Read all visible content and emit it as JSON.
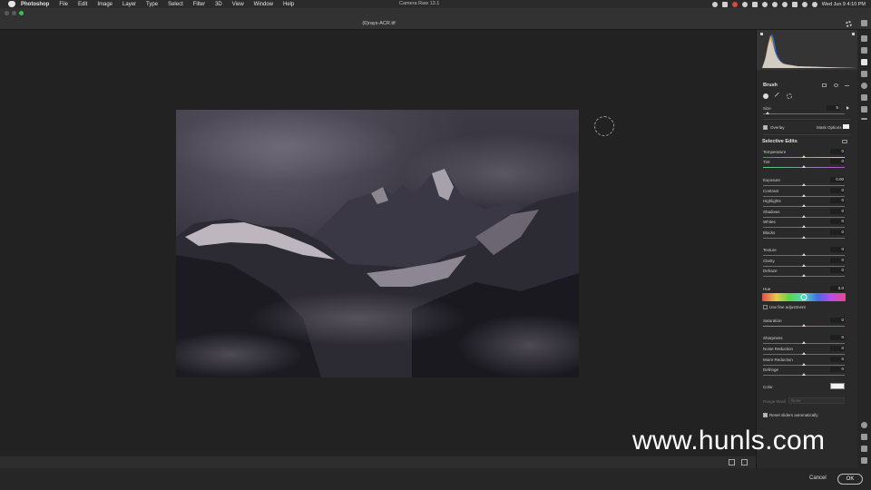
{
  "menubar": {
    "items": [
      "Photoshop",
      "File",
      "Edit",
      "Image",
      "Layer",
      "Type",
      "Select",
      "Filter",
      "3D",
      "View",
      "Window",
      "Help"
    ],
    "app_title": "Camera Raw 13.1",
    "clock": "Wed Jun 9  4:10 PM"
  },
  "window": {
    "filename": "(6)rays-ACR.tif"
  },
  "panel": {
    "brush_title": "Brush",
    "size_label": "Size",
    "size_value": "5",
    "overlay_label": "Overlay",
    "mask_options_label": "Mask Options",
    "selective_title": "Selective Edits",
    "sliders": [
      {
        "label": "Temperature",
        "value": "0",
        "pos": 0.5
      },
      {
        "label": "Tint",
        "value": "0",
        "pos": 0.5
      },
      {
        "label": "Exposure",
        "value": "0.00",
        "pos": 0.5
      },
      {
        "label": "Contrast",
        "value": "0",
        "pos": 0.5
      },
      {
        "label": "Highlights",
        "value": "0",
        "pos": 0.5
      },
      {
        "label": "Shadows",
        "value": "0",
        "pos": 0.5
      },
      {
        "label": "Whites",
        "value": "0",
        "pos": 0.5
      },
      {
        "label": "Blacks",
        "value": "0",
        "pos": 0.5
      },
      {
        "label": "Texture",
        "value": "0",
        "pos": 0.5
      },
      {
        "label": "Clarity",
        "value": "0",
        "pos": 0.5
      },
      {
        "label": "Dehaze",
        "value": "0",
        "pos": 0.5
      },
      {
        "label": "Hue",
        "value": "0.0",
        "pos": 0.5
      },
      {
        "label": "Saturation",
        "value": "0",
        "pos": 0.5
      },
      {
        "label": "Sharpness",
        "value": "0",
        "pos": 0.5
      },
      {
        "label": "Noise Reduction",
        "value": "0",
        "pos": 0.5
      },
      {
        "label": "Moire Reduction",
        "value": "0",
        "pos": 0.5
      },
      {
        "label": "Defringe",
        "value": "0",
        "pos": 0.5
      }
    ],
    "fine_adjust_label": "Use fine adjustment",
    "color_label": "Color",
    "range_mask_label": "Range Mask",
    "range_mask_value": "None",
    "reset_label": "Reset sliders automatically"
  },
  "footer": {
    "cancel_label": "Cancel",
    "ok_label": "OK"
  },
  "watermark": "www.hunls.com",
  "colors": {
    "accent_green": "#2ec448",
    "panel_bg": "#2a2a2a",
    "canvas_bg": "#222222"
  }
}
